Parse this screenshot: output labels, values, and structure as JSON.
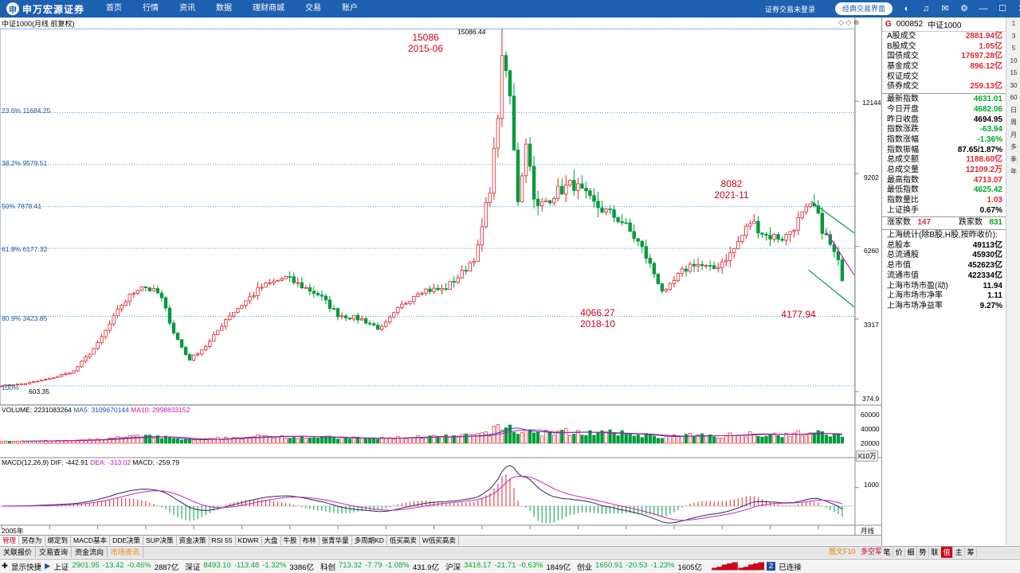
{
  "app": {
    "brand": "申万宏源证券",
    "nav": [
      "首页",
      "行情",
      "资讯",
      "数据",
      "理财商城",
      "交易",
      "账户"
    ],
    "login_status": "证券交易未登录",
    "classic_button": "经典交易界面"
  },
  "chart": {
    "title": "中证1000(月线 前复权)",
    "price_axis": [
      "12144",
      "9202",
      "6260",
      "3317",
      "374.9"
    ],
    "fib_levels": [
      {
        "label": "23.6% 11684.25",
        "value": 11684.25
      },
      {
        "label": "38.2% 9579.51",
        "value": 9579.51
      },
      {
        "label": "50% 7878.41",
        "value": 7878.41
      },
      {
        "label": "61.8% 6177.32",
        "value": 6177.32
      },
      {
        "label": "80.9% 3423.85",
        "value": 3423.85
      }
    ],
    "fib_top_label": "15086.44",
    "fib_bottom_label": "603.35",
    "fib_bottom_prefix": "100%",
    "annotations": [
      {
        "text1": "15086",
        "text2": "2015-06"
      },
      {
        "text1": "8082",
        "text2": "2021-11"
      },
      {
        "text1": "4066.27",
        "text2": "2018-10"
      },
      {
        "text1": "4177.94",
        "text2": ""
      }
    ],
    "volume_header": {
      "label": "VOLUME: 2231083264",
      "ma5": "MA5: 3109670144",
      "ma10": "MA10: 2998833152"
    },
    "volume_axis": [
      "60000",
      "40000",
      "20000"
    ],
    "volume_unit": "X10万",
    "macd_header": {
      "label": "MACD(12,26,9)",
      "dif": "DIF: -442.91",
      "dea": "DEA: -313.02",
      "macd": "MACD: -259.79"
    },
    "macd_axis": [
      "1000"
    ],
    "x_start_label": "2005年",
    "period_label": "月线"
  },
  "chart_data": {
    "type": "candlestick",
    "title": "中证1000(月线 前复权)",
    "x_range": [
      "2005-01",
      "2022-07"
    ],
    "ylim": [
      374.9,
      15086.44
    ],
    "key_points": [
      {
        "date": "2005",
        "value": 603.35
      },
      {
        "date": "2015-06",
        "value": 15086.44
      },
      {
        "date": "2018-10",
        "value": 4066.27
      },
      {
        "date": "2021-11",
        "value": 8082
      },
      {
        "date": "2022",
        "value": 4177.94
      }
    ],
    "anchors": [
      [
        2005.0,
        620
      ],
      [
        2005.5,
        700
      ],
      [
        2006.0,
        900
      ],
      [
        2006.5,
        1200
      ],
      [
        2007.0,
        2300
      ],
      [
        2007.5,
        3900
      ],
      [
        2007.9,
        4700
      ],
      [
        2008.3,
        4300
      ],
      [
        2008.6,
        2700
      ],
      [
        2008.9,
        1650
      ],
      [
        2009.3,
        2300
      ],
      [
        2009.7,
        3400
      ],
      [
        2010.0,
        3900
      ],
      [
        2010.4,
        4600
      ],
      [
        2010.9,
        5000
      ],
      [
        2011.2,
        4700
      ],
      [
        2011.6,
        4300
      ],
      [
        2012.0,
        3500
      ],
      [
        2012.5,
        3300
      ],
      [
        2012.9,
        2900
      ],
      [
        2013.3,
        3800
      ],
      [
        2013.7,
        4500
      ],
      [
        2014.2,
        4500
      ],
      [
        2014.6,
        5200
      ],
      [
        2014.9,
        6000
      ],
      [
        2015.2,
        9000
      ],
      [
        2015.45,
        14000
      ],
      [
        2015.6,
        12000
      ],
      [
        2015.75,
        8200
      ],
      [
        2015.95,
        10800
      ],
      [
        2016.1,
        7700
      ],
      [
        2016.5,
        8400
      ],
      [
        2016.9,
        8800
      ],
      [
        2017.3,
        8000
      ],
      [
        2017.9,
        7300
      ],
      [
        2018.3,
        6300
      ],
      [
        2018.8,
        4300
      ],
      [
        2019.1,
        5100
      ],
      [
        2019.4,
        5600
      ],
      [
        2019.8,
        5300
      ],
      [
        2020.2,
        6000
      ],
      [
        2020.6,
        7300
      ],
      [
        2020.9,
        6700
      ],
      [
        2021.3,
        6600
      ],
      [
        2021.7,
        7600
      ],
      [
        2021.9,
        7900
      ],
      [
        2022.1,
        6900
      ],
      [
        2022.4,
        5700
      ],
      [
        2022.6,
        4300
      ],
      [
        2022.7,
        4631
      ]
    ],
    "volume_ylim": [
      0,
      60000
    ],
    "macd_ylim": [
      -600,
      1500
    ]
  },
  "quote": {
    "code_prefix": "G",
    "code": "000852",
    "name": "中证1000",
    "rows1": [
      {
        "k": "A股成交",
        "v": "2881.94亿",
        "c": "red"
      },
      {
        "k": "B股成交",
        "v": "1.05亿",
        "c": "red"
      },
      {
        "k": "国债成交",
        "v": "17697.28亿",
        "c": "red"
      },
      {
        "k": "基金成交",
        "v": "896.12亿",
        "c": "red"
      },
      {
        "k": "权证成交",
        "v": "",
        "c": "red"
      },
      {
        "k": "债券成交",
        "v": "259.13亿",
        "c": "red"
      }
    ],
    "rows2": [
      {
        "k": "最新指数",
        "v": "4631.01",
        "c": "green"
      },
      {
        "k": "今日开盘",
        "v": "4682.06",
        "c": "green"
      },
      {
        "k": "昨日收盘",
        "v": "4694.95",
        "c": "blk"
      },
      {
        "k": "指数涨跌",
        "v": "-63.94",
        "c": "green"
      },
      {
        "k": "指数涨幅",
        "v": "-1.36%",
        "c": "green"
      },
      {
        "k": "指数振幅",
        "v": "87.65/1.87%",
        "c": "blk"
      },
      {
        "k": "总成交额",
        "v": "1188.60亿",
        "c": "red"
      },
      {
        "k": "总成交量",
        "v": "12109.2万",
        "c": "red"
      },
      {
        "k": "最高指数",
        "v": "4713.07",
        "c": "red"
      },
      {
        "k": "最低指数",
        "v": "4625.42",
        "c": "green"
      },
      {
        "k": "指数量比",
        "v": "1.03",
        "c": "red"
      },
      {
        "k": "上证换手",
        "v": "0.67%",
        "c": "blk"
      }
    ],
    "updown": {
      "up_label": "涨家数",
      "up": "147",
      "down_label": "跌家数",
      "down": "831"
    },
    "sh_title": "上海统计(除B股,H股,按昨收价):",
    "rows3": [
      {
        "k": "总股本",
        "v": "49113亿"
      },
      {
        "k": "总流通股",
        "v": "45930亿"
      },
      {
        "k": "总市值",
        "v": "452623亿"
      },
      {
        "k": "流通市值",
        "v": "422334亿"
      },
      {
        "k": "上海市场市盈(动)",
        "v": "11.94"
      },
      {
        "k": "上海市场市净率",
        "v": "1.11"
      },
      {
        "k": "上海市场净益率",
        "v": "9.27%"
      }
    ]
  },
  "side_icons": [
    "1",
    "3",
    "5",
    "10",
    "15",
    "30",
    "60",
    "日",
    "周",
    "月",
    "多",
    "季",
    "年"
  ],
  "tabs": [
    "管理",
    "另存为",
    "绑定到",
    "MACD基本",
    "DDE决策",
    "SUP决策",
    "资金决策",
    "RSI 55",
    "KDWR",
    "大盘",
    "牛股",
    "布林",
    "张青华量",
    "多周期KD",
    "低买高卖",
    "W低买高卖"
  ],
  "subtabs": [
    "关联报价",
    "交易查询",
    "资金流向",
    "市场资讯"
  ],
  "subtabs_right": [
    "图文F10",
    "多空军"
  ],
  "right_tabs": [
    "笔",
    "价",
    "细",
    "势",
    "联",
    "值",
    "主",
    "筹"
  ],
  "status": {
    "menu": "显示快捷",
    "indices": [
      {
        "name": "上证",
        "val": "2901.95",
        "chg": "-13.42",
        "pct": "-0.46%",
        "amt": "2887亿"
      },
      {
        "name": "深证",
        "val": "8493.10",
        "chg": "-113.48",
        "pct": "-1.32%",
        "amt": "3386亿"
      },
      {
        "name": "科创",
        "val": "713.32",
        "chg": "-7.79",
        "pct": "-1.08%",
        "amt": "431.9亿"
      },
      {
        "name": "沪深",
        "val": "3418.17",
        "chg": "-21.71",
        "pct": "-0.63%",
        "amt": "1849亿"
      },
      {
        "name": "创业",
        "val": "1650.91",
        "chg": "-20.53",
        "pct": "-1.23%",
        "amt": "1605亿"
      }
    ],
    "conn_badge": "2",
    "connected": "已连接"
  }
}
